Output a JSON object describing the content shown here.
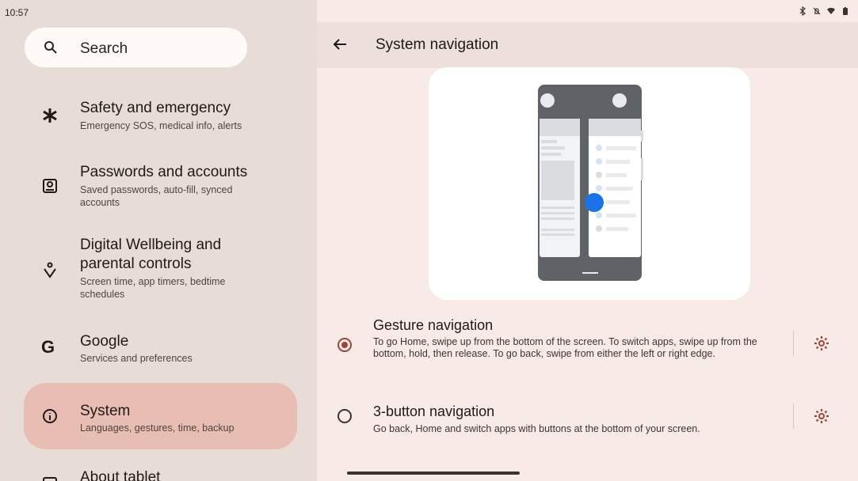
{
  "status_bar": {
    "time": "10:57",
    "icons": [
      "bluetooth-icon",
      "notifications-off-icon",
      "wifi-icon",
      "battery-icon"
    ]
  },
  "search": {
    "label": "Search"
  },
  "sidebar": {
    "items": [
      {
        "icon": "asterisk-icon",
        "title": "Safety and emergency",
        "subtitle": "Emergency SOS, medical info, alerts"
      },
      {
        "icon": "account-box-icon",
        "title": "Passwords and accounts",
        "subtitle": "Saved passwords, auto-fill, synced accounts"
      },
      {
        "icon": "wellbeing-icon",
        "title": "Digital Wellbeing and parental controls",
        "subtitle": "Screen time, app timers, bedtime schedules"
      },
      {
        "icon": "google-icon",
        "title": "Google",
        "subtitle": "Services and preferences"
      },
      {
        "icon": "info-icon",
        "title": "System",
        "subtitle": "Languages, gestures, time, backup",
        "selected": true
      },
      {
        "icon": "tablet-icon",
        "title": "About tablet",
        "subtitle": ""
      }
    ]
  },
  "header": {
    "title": "System navigation"
  },
  "options": [
    {
      "title": "Gesture navigation",
      "description": "To go Home, swipe up from the bottom of the screen. To switch apps, swipe up from the bottom, hold, then release. To go back, swipe from either the left or right edge.",
      "selected": true
    },
    {
      "title": "3-button navigation",
      "description": "Go back, Home and switch apps with buttons at the bottom of your screen.",
      "selected": false
    }
  ],
  "colors": {
    "accent": "#9c4535",
    "selected_bg": "#e8bdb3",
    "pane_bg": "#f8ebe7"
  }
}
